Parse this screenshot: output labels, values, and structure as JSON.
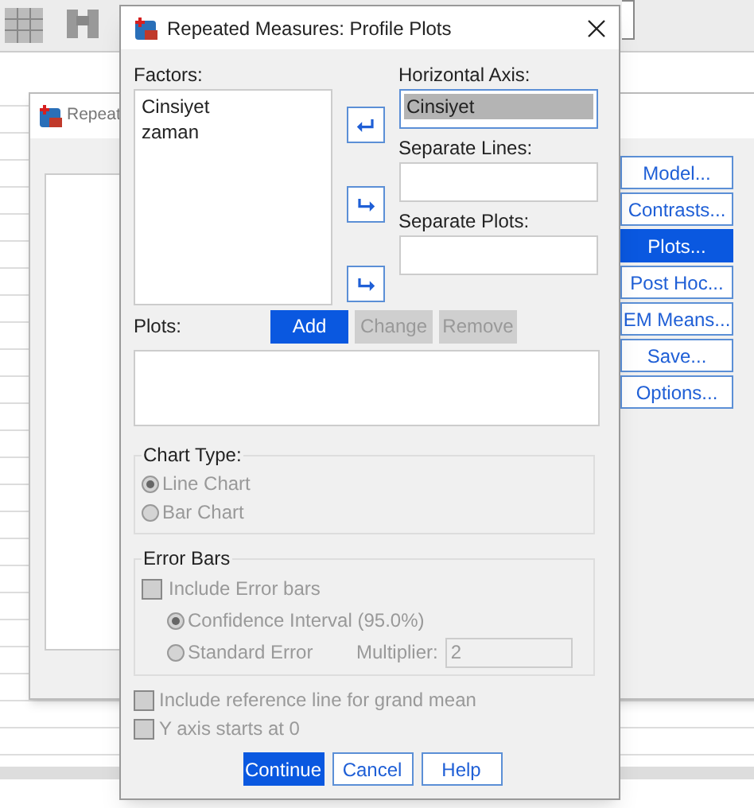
{
  "background_window": {
    "title": "Repeat",
    "buttons": [
      {
        "label": "Model...",
        "selected": false
      },
      {
        "label": "Contrasts...",
        "selected": false
      },
      {
        "label": "Plots...",
        "selected": true
      },
      {
        "label": "Post Hoc...",
        "selected": false
      },
      {
        "label": "EM Means...",
        "selected": false
      },
      {
        "label": "Save...",
        "selected": false
      },
      {
        "label": "Options...",
        "selected": false
      }
    ]
  },
  "dialog": {
    "title": "Repeated Measures: Profile Plots"
  },
  "factors": {
    "label": "Factors:",
    "items": [
      "Cinsiyet",
      "zaman"
    ]
  },
  "targets": [
    {
      "label": "Horizontal Axis:",
      "value": "Cinsiyet",
      "kind": "left"
    },
    {
      "label": "Separate Lines:",
      "kind": "right"
    },
    {
      "label": "Separate Plots:",
      "kind": "right"
    }
  ],
  "plots": {
    "label": "Plots:",
    "buttons": [
      {
        "label": "Add",
        "disabled": false
      },
      {
        "label": "Change",
        "disabled": true
      },
      {
        "label": "Remove",
        "disabled": true
      }
    ]
  },
  "chart_type": {
    "title": "Chart Type:",
    "options": [
      {
        "label": "Line Chart",
        "selected": true
      },
      {
        "label": "Bar Chart",
        "selected": false
      }
    ]
  },
  "error_bars": {
    "title": "Error Bars",
    "include": {
      "label": "Include Error bars",
      "checked": false
    },
    "options": [
      {
        "label": "Confidence Interval (95.0%)",
        "selected": true
      },
      {
        "label": "Standard Error",
        "selected": false
      }
    ],
    "multiplier": {
      "label": "Multiplier:",
      "value": "2"
    }
  },
  "checkboxes": [
    {
      "label": "Include reference line for grand mean",
      "checked": false
    },
    {
      "label": "Y axis starts at 0",
      "checked": false
    }
  ],
  "footer_buttons": [
    {
      "label": "Continue",
      "selected": true
    },
    {
      "label": "Cancel",
      "selected": false
    },
    {
      "label": "Help",
      "selected": false
    }
  ]
}
